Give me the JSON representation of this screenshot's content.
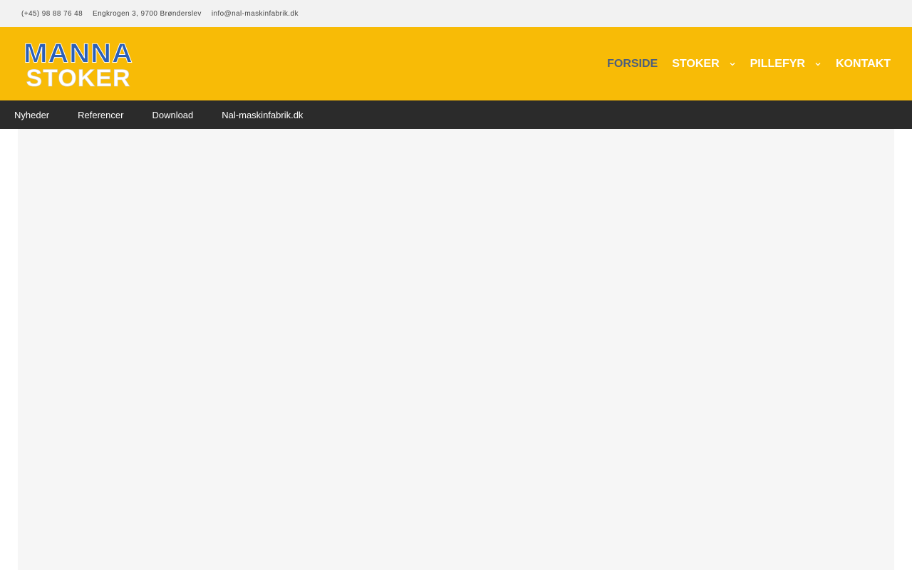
{
  "topbar": {
    "phone": "(+45) 98 88 76 48",
    "address": "Engkrogen 3, 9700 Brønderslev",
    "email": "info@nal-maskinfabrik.dk"
  },
  "logo": {
    "line1": "MANNA",
    "line2": "STOKER"
  },
  "mainnav": {
    "items": [
      {
        "label": "FORSIDE",
        "active": true
      },
      {
        "label": "STOKER",
        "has_dropdown": true,
        "icon": "chevron-down-icon"
      },
      {
        "label": "PILLEFYR",
        "has_dropdown": true,
        "icon": "chevron-down-icon"
      },
      {
        "label": "KONTAKT"
      }
    ]
  },
  "subnav": {
    "items": [
      {
        "label": "Nyheder"
      },
      {
        "label": "Referencer"
      },
      {
        "label": "Download"
      },
      {
        "label": "Nal-maskinfabrik.dk"
      }
    ]
  },
  "colors": {
    "header_bg": "#f8bb06",
    "topbar_bg": "#f2f2f2",
    "subnav_bg": "#2b2b2b",
    "active_nav": "#4b5e7e",
    "logo_blue": "#2a5fb8"
  }
}
